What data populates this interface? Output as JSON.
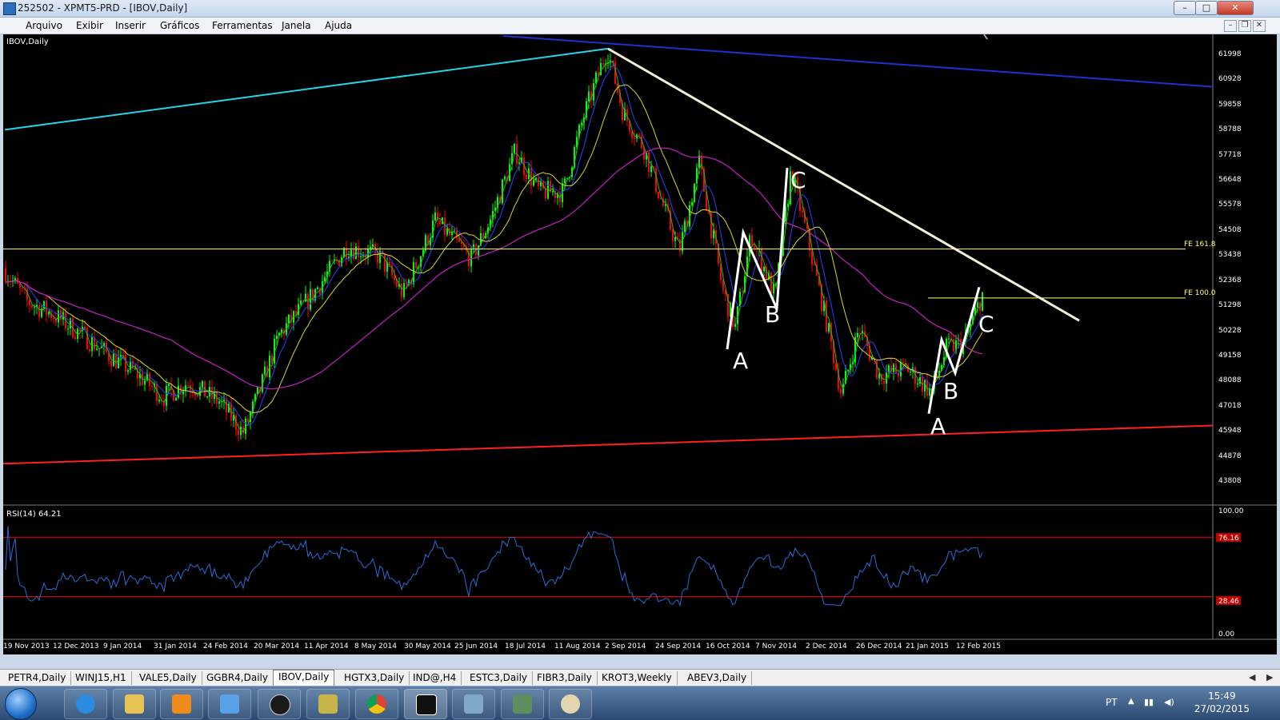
{
  "window": {
    "title": "252502 - XPMT5-PRD - [IBOV,Daily]"
  },
  "menu": {
    "items": [
      "Arquivo",
      "Exibir",
      "Inserir",
      "Gráficos",
      "Ferramentas",
      "Janela",
      "Ajuda"
    ]
  },
  "chart": {
    "symbol_label": "IBOV,Daily",
    "rsi_label": "RSI(14) 64.21",
    "price_ticks": [
      "61998",
      "60928",
      "59858",
      "58788",
      "57718",
      "56648",
      "55578",
      "54508",
      "53438",
      "52368",
      "51298",
      "50228",
      "49158",
      "48088",
      "47018",
      "45948",
      "44878",
      "43808"
    ],
    "rsi_ticks": [
      "100.00",
      "76.16",
      "28.46",
      "0.00"
    ],
    "date_labels": [
      "19 Nov 2013",
      "12 Dec 2013",
      "9 Jan 2014",
      "31 Jan 2014",
      "24 Feb 2014",
      "20 Mar 2014",
      "11 Apr 2014",
      "8 May 2014",
      "30 May 2014",
      "25 Jun 2014",
      "18 Jul 2014",
      "11 Aug 2014",
      "2 Sep 2014",
      "24 Sep 2014",
      "16 Oct 2014",
      "7 Nov 2014",
      "2 Dec 2014",
      "26 Dec 2014",
      "21 Jan 2015",
      "12 Feb 2015"
    ],
    "fe_labels": [
      "FE 161.8",
      "FE 100.0"
    ],
    "wave_labels": [
      "A",
      "B",
      "C",
      "A",
      "B",
      "C"
    ]
  },
  "chart_data": {
    "type": "candlestick",
    "series": [
      {
        "name": "IBOV,Daily"
      },
      {
        "name": "RSI(14) 64.21",
        "last": 64.21
      }
    ],
    "ylim": [
      43000,
      62700
    ],
    "rsi_levels": [
      76.16,
      28.46
    ],
    "fe_levels": [
      {
        "label": "FE 161.8",
        "price": 53700
      },
      {
        "label": "FE 100.0",
        "price": 51650
      }
    ],
    "colors": {
      "bull": "#00ff00",
      "bear": "#ff0000",
      "ma_fast": "#1dbd1d",
      "ma_mid": "#2640ff",
      "ma_slow": "#d8d82a",
      "ma_long": "#c51fc5",
      "rsi": "#2c6bd9"
    }
  },
  "tabs": {
    "items": [
      "PETR4,Daily",
      "WINJ15,H1",
      "VALE5,Daily",
      "GGBR4,Daily",
      "IBOV,Daily",
      "HGTX3,Daily",
      "IND@,H4",
      "ESTC3,Daily",
      "FIBR3,Daily",
      "KROT3,Weekly",
      "ABEV3,Daily"
    ],
    "active": "IBOV,Daily"
  },
  "taskbar": {
    "lang": "PT",
    "time": "15:49",
    "date": "27/02/2015"
  }
}
